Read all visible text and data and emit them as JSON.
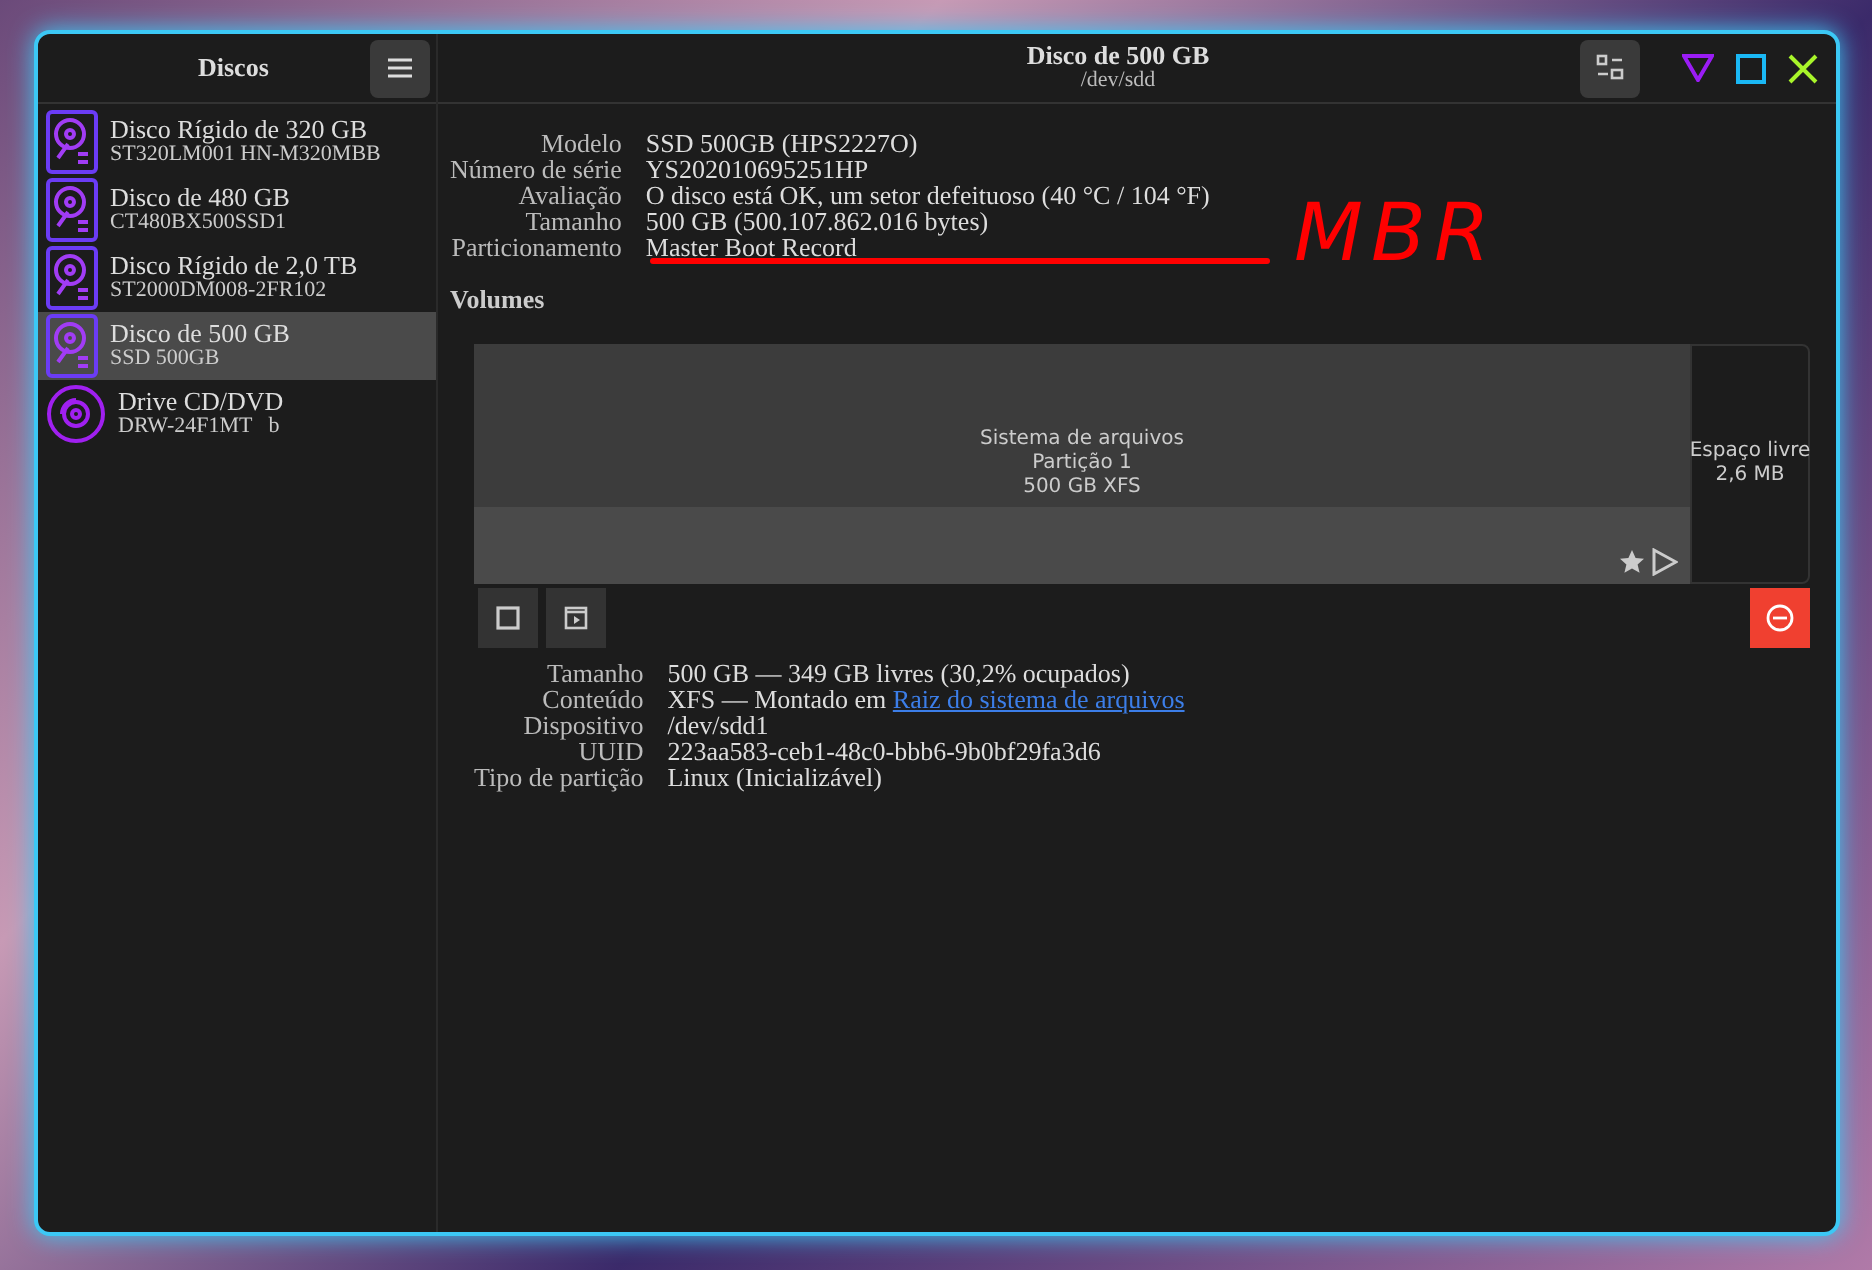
{
  "sidebar": {
    "title": "Discos",
    "items": [
      {
        "kind": "hdd",
        "name": "Disco Rígido de 320 GB",
        "model": "ST320LM001 HN-M320MBB",
        "selected": false
      },
      {
        "kind": "hdd",
        "name": "Disco de 480 GB",
        "model": "CT480BX500SSD1",
        "selected": false
      },
      {
        "kind": "hdd",
        "name": "Disco Rígido de 2,0 TB",
        "model": "ST2000DM008-2FR102",
        "selected": false
      },
      {
        "kind": "hdd",
        "name": "Disco de 500 GB",
        "model": "SSD 500GB",
        "selected": true
      },
      {
        "kind": "optical",
        "name": "Drive CD/DVD",
        "model": "DRW-24F1MT   b",
        "selected": false
      }
    ]
  },
  "header": {
    "title": "Disco de 500 GB",
    "subtitle": "/dev/sdd"
  },
  "disk_info": [
    {
      "label": "Modelo",
      "value": "SSD 500GB (HPS2227O)"
    },
    {
      "label": "Número de série",
      "value": "YS202010695251HP"
    },
    {
      "label": "Avaliação",
      "value": "O disco está OK, um setor defeituoso (40 °C / 104 °F)"
    },
    {
      "label": "Tamanho",
      "value": "500 GB (500.107.862.016 bytes)"
    },
    {
      "label": "Particionamento",
      "value": "Master Boot Record"
    }
  ],
  "annotation": {
    "text": "MBR"
  },
  "volumes_heading": "Volumes",
  "volumes": [
    {
      "kind": "partition",
      "lines": [
        "Sistema de arquivos",
        "Partição 1",
        "500 GB XFS"
      ],
      "selected": true
    },
    {
      "kind": "free",
      "lines": [
        "Espaço livre",
        "2,6 MB"
      ],
      "selected": false
    }
  ],
  "partition_info": [
    {
      "label": "Tamanho",
      "value": "500 GB — 349 GB livres (30,2% ocupados)"
    },
    {
      "label": "Conteúdo",
      "value": "XFS — Montado em ",
      "link": "Raiz do sistema de arquivos"
    },
    {
      "label": "Dispositivo",
      "value": "/dev/sdd1"
    },
    {
      "label": "UUID",
      "value": "223aa583-ceb1-48c0-bbb6-9b0bf29fa3d6"
    },
    {
      "label": "Tipo de partição",
      "value": "Linux (Inicializável)"
    }
  ]
}
